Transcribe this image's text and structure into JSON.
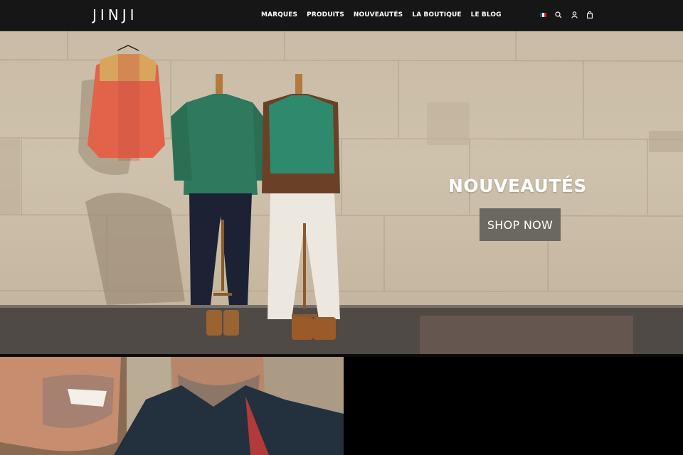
{
  "header": {
    "logo": "JINJI",
    "nav": [
      "MARQUES",
      "PRODUITS",
      "NOUVEAUTÉS",
      "LA BOUTIQUE",
      "LE BLOG"
    ],
    "icons": [
      "french-flag-icon",
      "search-icon",
      "user-icon",
      "shopping-bag-icon"
    ]
  },
  "hero": {
    "title": "NOUVEAUTÉS",
    "button_label": "SHOP NOW",
    "image": "mannequins-with-down-vests-against-stone-wall"
  },
  "secondary_banner": {
    "image": "smiling-bearded-man-in-denim-jacket"
  },
  "colors": {
    "header_bg": "#161616",
    "button_bg": "#6b6761",
    "text_light": "#ffffff"
  }
}
